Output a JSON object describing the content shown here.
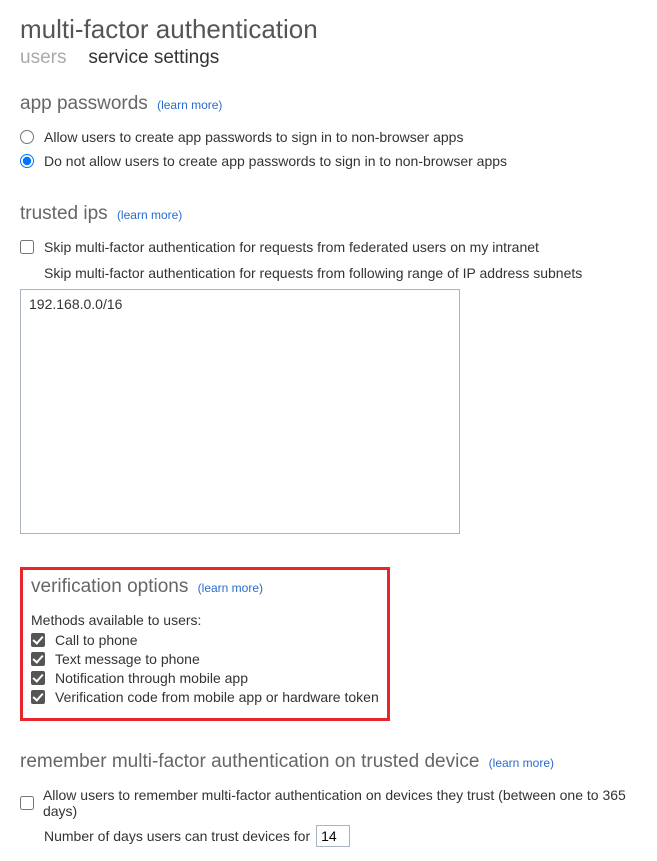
{
  "header": {
    "title": "multi-factor authentication",
    "tabs": [
      {
        "label": "users",
        "active": false
      },
      {
        "label": "service settings",
        "active": true
      }
    ]
  },
  "learn_more": "(learn more)",
  "app_passwords": {
    "title": "app passwords",
    "options": [
      {
        "label": "Allow users to create app passwords to sign in to non-browser apps",
        "selected": false
      },
      {
        "label": "Do not allow users to create app passwords to sign in to non-browser apps",
        "selected": true
      }
    ]
  },
  "trusted_ips": {
    "title": "trusted ips",
    "skip_federated": {
      "label": "Skip multi-factor authentication for requests from federated users on my intranet",
      "checked": false
    },
    "subnet_label": "Skip multi-factor authentication for requests from following range of IP address subnets",
    "subnet_value": "192.168.0.0/16"
  },
  "verification_options": {
    "title": "verification options",
    "sub_label": "Methods available to users:",
    "methods": [
      {
        "label": "Call to phone",
        "checked": true
      },
      {
        "label": "Text message to phone",
        "checked": true
      },
      {
        "label": "Notification through mobile app",
        "checked": true
      },
      {
        "label": "Verification code from mobile app or hardware token",
        "checked": true
      }
    ]
  },
  "remember": {
    "title": "remember multi-factor authentication on trusted device",
    "allow": {
      "label": "Allow users to remember multi-factor authentication on devices they trust (between one to 365 days)",
      "checked": false
    },
    "days_label": "Number of days users can trust devices for",
    "days_value": "14"
  }
}
